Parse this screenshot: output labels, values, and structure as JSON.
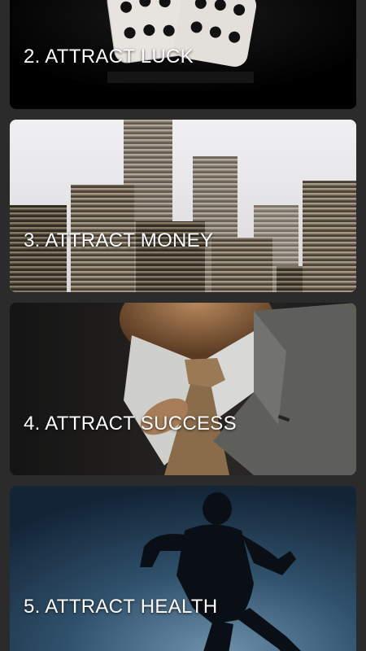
{
  "cards": [
    {
      "title": "2. ATTRACT LUCK",
      "image": "dice"
    },
    {
      "title": "3. ATTRACT MONEY",
      "image": "coin-stacks"
    },
    {
      "title": "4. ATTRACT SUCCESS",
      "image": "businessman-tie"
    },
    {
      "title": "5. ATTRACT HEALTH",
      "image": "runner-silhouette"
    }
  ],
  "colors": {
    "background": "#2b2b2b",
    "label_text": "#ffffff"
  }
}
